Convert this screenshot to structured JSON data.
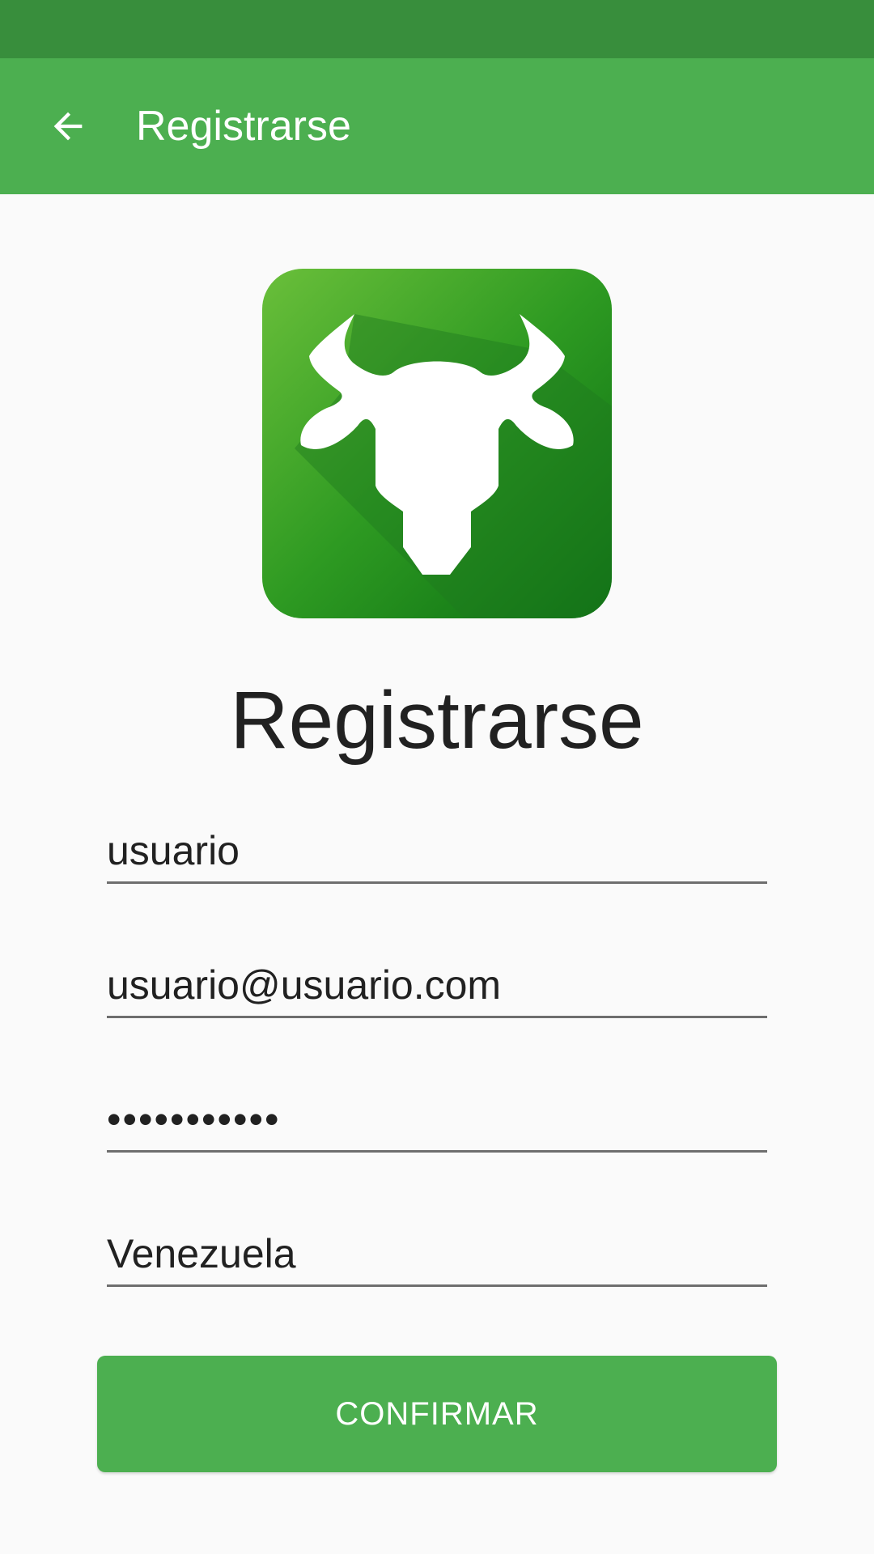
{
  "app_bar": {
    "title": "Registrarse",
    "back_icon": "arrow-left-icon"
  },
  "logo": {
    "icon": "bull-head-icon",
    "colors": {
      "gradient_start": "#6abf3a",
      "gradient_end": "#006400",
      "shadow": "#1e7a1e"
    }
  },
  "heading": "Registrarse",
  "form": {
    "username": "usuario",
    "email": "usuario@usuario.com",
    "password": "•••••••••••",
    "country": "Venezuela"
  },
  "confirm_button": {
    "label": "CONFIRMAR"
  },
  "colors": {
    "status_bar": "#388e3c",
    "app_bar": "#4caf50",
    "button": "#4caf50",
    "background": "#fafafa",
    "text": "#212121"
  }
}
